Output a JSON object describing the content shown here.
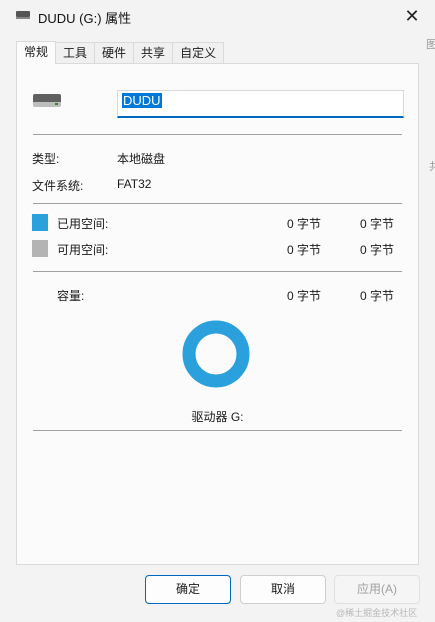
{
  "window": {
    "title": "DUDU (G:) 属性",
    "close_glyph": "✕"
  },
  "tabs": [
    {
      "label": "常规",
      "active": true
    },
    {
      "label": "工具",
      "active": false
    },
    {
      "label": "硬件",
      "active": false
    },
    {
      "label": "共享",
      "active": false
    },
    {
      "label": "自定义",
      "active": false
    }
  ],
  "general": {
    "drive_icon": "drive-icon",
    "name_value": "DUDU",
    "type_label": "类型:",
    "type_value": "本地磁盘",
    "fs_label": "文件系统:",
    "fs_value": "FAT32",
    "used": {
      "label": "已用空间:",
      "bytes": "0 字节",
      "size": "0 字节",
      "color": "#2aa0dc"
    },
    "free": {
      "label": "可用空间:",
      "bytes": "0 字节",
      "size": "0 字节",
      "color": "#b4b4b4"
    },
    "capacity": {
      "label": "容量:",
      "bytes": "0 字节",
      "size": "0 字节"
    },
    "chart_color": "#2aa0dc",
    "drive_label": "驱动器 G:"
  },
  "buttons": {
    "ok": "确定",
    "cancel": "取消",
    "apply": "应用(A)"
  },
  "watermark": "@稀土掘金技术社区",
  "background_fragments": [
    "图",
    "共"
  ]
}
